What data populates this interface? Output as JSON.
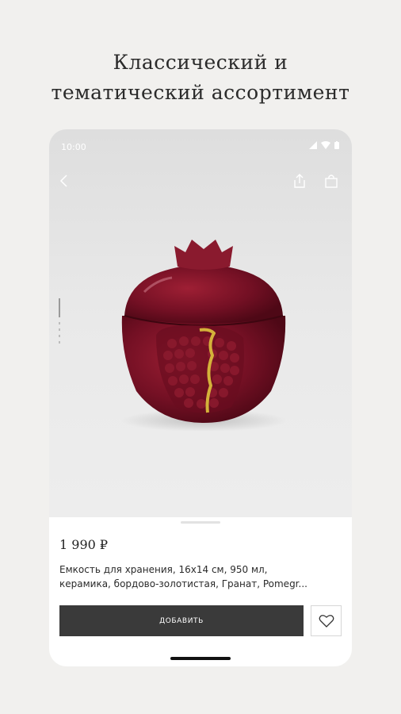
{
  "headline": {
    "line1": "Классический и",
    "line2": "тематический ассортимент"
  },
  "status_bar": {
    "time": "10:00",
    "icons": [
      "signal-icon",
      "wifi-icon",
      "battery-icon"
    ]
  },
  "toolbar": {
    "icons": [
      "back-icon",
      "share-icon",
      "bag-icon"
    ]
  },
  "product": {
    "price": "1 990 ₽",
    "title_line1": "Емкость для хранения, 16х14 см, 950 мл,",
    "title_line2": "керамика, бордово-золотистая, Гранат, Pomegr...",
    "add_label": "ДОБАВИТЬ",
    "image_description_icon": "pomegranate-jar-image"
  },
  "colors": {
    "background": "#f1f0ee",
    "button": "#3a3a3a",
    "product_red": "#7a0f22",
    "accent_gold": "#d4b23a"
  }
}
